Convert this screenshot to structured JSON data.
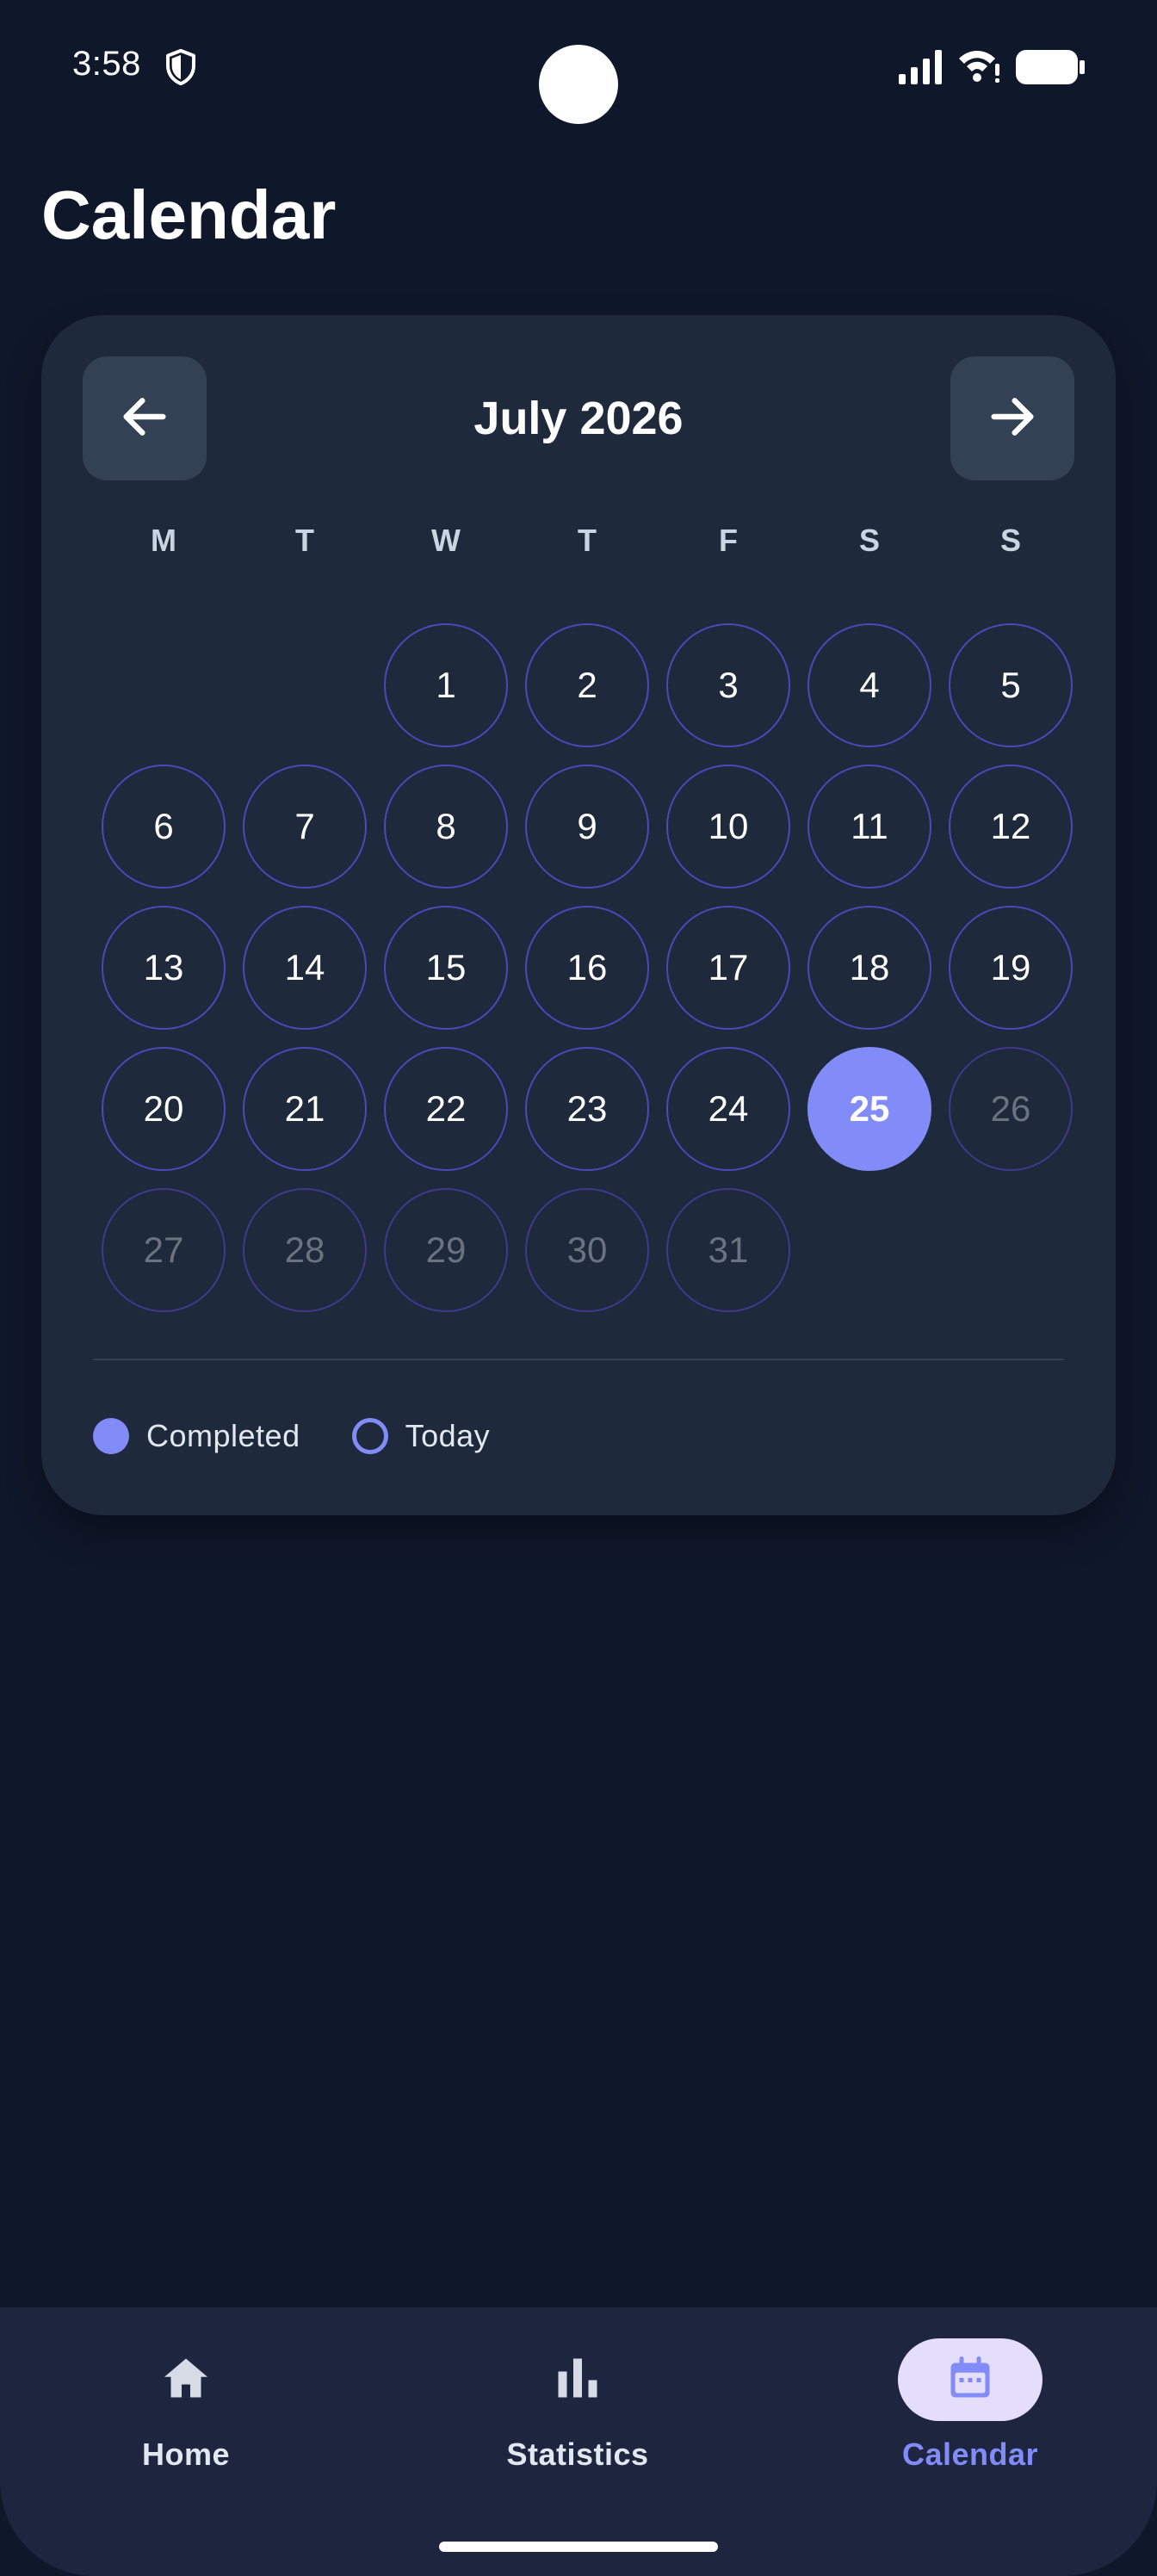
{
  "status_bar": {
    "time": "3:58",
    "icons": [
      "shield-icon",
      "signal-icon",
      "wifi-icon",
      "battery-icon"
    ]
  },
  "page": {
    "title": "Calendar"
  },
  "calendar": {
    "month_label": "July 2026",
    "prev_icon": "arrow-left-icon",
    "next_icon": "arrow-right-icon",
    "weekdays": [
      "M",
      "T",
      "W",
      "T",
      "F",
      "S",
      "S"
    ],
    "leading_blanks": 2,
    "days": [
      {
        "label": "1",
        "state": "past"
      },
      {
        "label": "2",
        "state": "past"
      },
      {
        "label": "3",
        "state": "past"
      },
      {
        "label": "4",
        "state": "past"
      },
      {
        "label": "5",
        "state": "past"
      },
      {
        "label": "6",
        "state": "past"
      },
      {
        "label": "7",
        "state": "past"
      },
      {
        "label": "8",
        "state": "past"
      },
      {
        "label": "9",
        "state": "past"
      },
      {
        "label": "10",
        "state": "past"
      },
      {
        "label": "11",
        "state": "past"
      },
      {
        "label": "12",
        "state": "past"
      },
      {
        "label": "13",
        "state": "past"
      },
      {
        "label": "14",
        "state": "past"
      },
      {
        "label": "15",
        "state": "past"
      },
      {
        "label": "16",
        "state": "past"
      },
      {
        "label": "17",
        "state": "past"
      },
      {
        "label": "18",
        "state": "past"
      },
      {
        "label": "19",
        "state": "past"
      },
      {
        "label": "20",
        "state": "past"
      },
      {
        "label": "21",
        "state": "past"
      },
      {
        "label": "22",
        "state": "past"
      },
      {
        "label": "23",
        "state": "past"
      },
      {
        "label": "24",
        "state": "past"
      },
      {
        "label": "25",
        "state": "today"
      },
      {
        "label": "26",
        "state": "future"
      },
      {
        "label": "27",
        "state": "future"
      },
      {
        "label": "28",
        "state": "future"
      },
      {
        "label": "29",
        "state": "future"
      },
      {
        "label": "30",
        "state": "future"
      },
      {
        "label": "31",
        "state": "future"
      }
    ],
    "legend": [
      {
        "label": "Completed",
        "style": "filled"
      },
      {
        "label": "Today",
        "style": "outline"
      }
    ]
  },
  "bottom_nav": {
    "items": [
      {
        "label": "Home",
        "icon": "home-icon",
        "selected": false
      },
      {
        "label": "Statistics",
        "icon": "bar-chart-icon",
        "selected": false
      },
      {
        "label": "Calendar",
        "icon": "calendar-icon",
        "selected": true
      }
    ]
  },
  "colors": {
    "background": "#0f172a",
    "card": "#1e293b",
    "accent": "#818cf8",
    "ring": "#4f46b8",
    "nav_background": "#1e253f",
    "selected_pill": "#e5defa"
  }
}
